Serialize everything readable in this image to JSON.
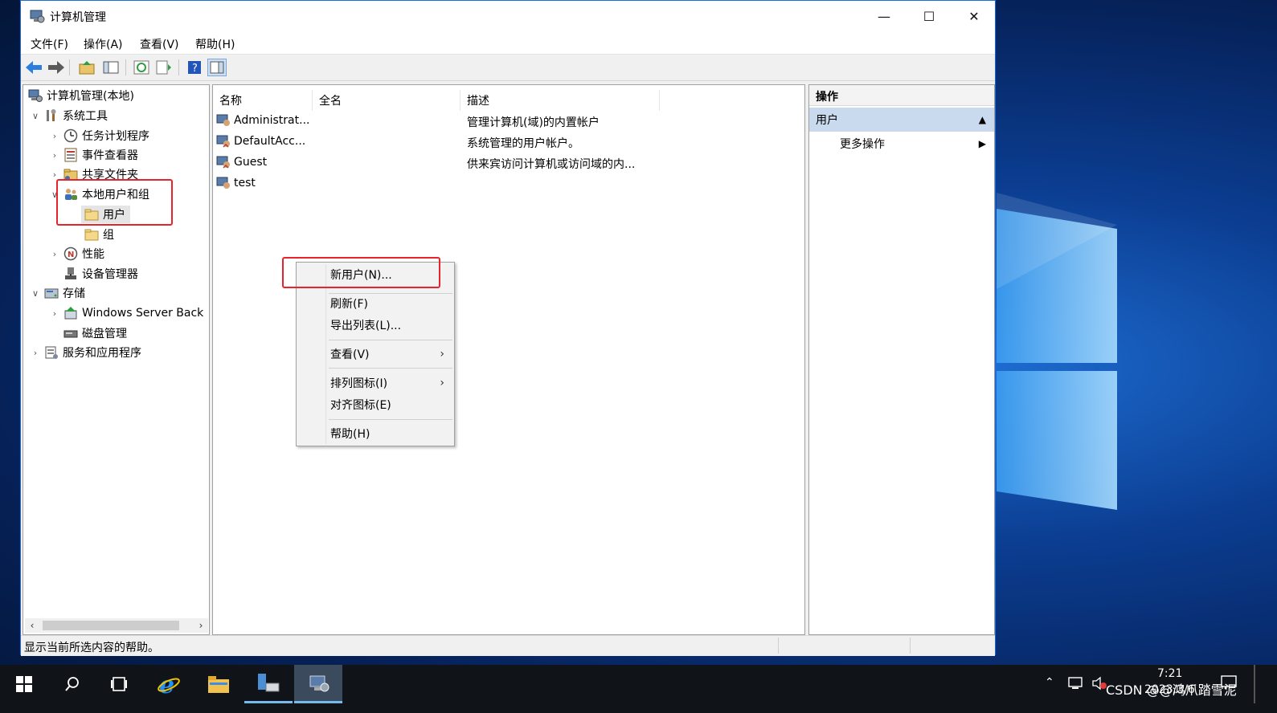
{
  "window": {
    "title": "计算机管理"
  },
  "menubar": [
    "文件(F)",
    "操作(A)",
    "查看(V)",
    "帮助(H)"
  ],
  "tree": {
    "root": "计算机管理(本地)",
    "system_tools": "系统工具",
    "task_scheduler": "任务计划程序",
    "event_viewer": "事件查看器",
    "shared_folders": "共享文件夹",
    "local_users_groups": "本地用户和组",
    "users": "用户",
    "groups": "组",
    "performance": "性能",
    "device_manager": "设备管理器",
    "storage": "存储",
    "windows_server_backup": "Windows Server Back",
    "disk_management": "磁盘管理",
    "services_apps": "服务和应用程序"
  },
  "list": {
    "columns": [
      "名称",
      "全名",
      "描述"
    ],
    "rows": [
      {
        "name": "Administrat...",
        "fullname": "",
        "desc": "管理计算机(域)的内置帐户"
      },
      {
        "name": "DefaultAcc...",
        "fullname": "",
        "desc": "系统管理的用户帐户。"
      },
      {
        "name": "Guest",
        "fullname": "",
        "desc": "供来宾访问计算机或访问域的内..."
      },
      {
        "name": "test",
        "fullname": "",
        "desc": ""
      }
    ]
  },
  "context_menu": {
    "new_user": "新用户(N)...",
    "refresh": "刷新(F)",
    "export": "导出列表(L)...",
    "view": "查看(V)",
    "arrange": "排列图标(I)",
    "align": "对齐图标(E)",
    "help": "帮助(H)"
  },
  "actions": {
    "header": "操作",
    "section": "用户",
    "more": "更多操作"
  },
  "status": {
    "text": "显示当前所选内容的帮助。"
  },
  "taskbar": {
    "time": "7:21",
    "date": "2023/3/6",
    "watermark": "CSDN @@鸿爪踏雪泥"
  },
  "colors": {
    "highlight_red": "#e8232b",
    "window_border": "#1a6ed8",
    "action_section": "#c9d9ee"
  }
}
